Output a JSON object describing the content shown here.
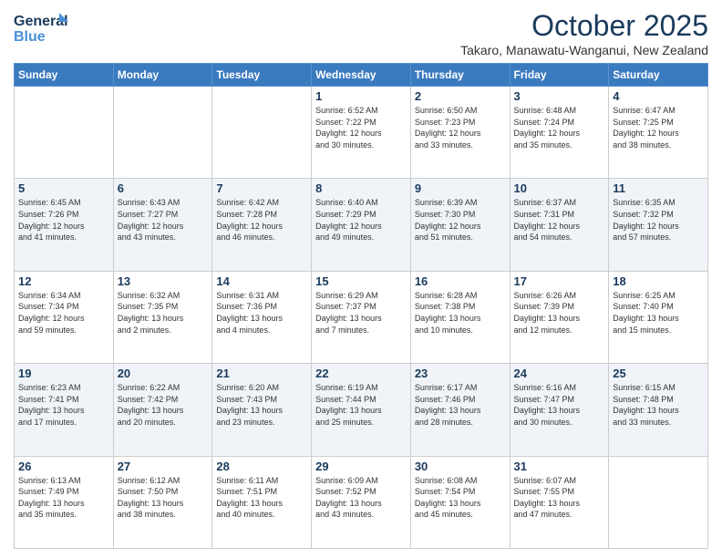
{
  "logo": {
    "line1": "General",
    "line2": "Blue"
  },
  "title": "October 2025",
  "location": "Takaro, Manawatu-Wanganui, New Zealand",
  "days_of_week": [
    "Sunday",
    "Monday",
    "Tuesday",
    "Wednesday",
    "Thursday",
    "Friday",
    "Saturday"
  ],
  "weeks": [
    [
      {
        "day": "",
        "info": ""
      },
      {
        "day": "",
        "info": ""
      },
      {
        "day": "",
        "info": ""
      },
      {
        "day": "1",
        "info": "Sunrise: 6:52 AM\nSunset: 7:22 PM\nDaylight: 12 hours\nand 30 minutes."
      },
      {
        "day": "2",
        "info": "Sunrise: 6:50 AM\nSunset: 7:23 PM\nDaylight: 12 hours\nand 33 minutes."
      },
      {
        "day": "3",
        "info": "Sunrise: 6:48 AM\nSunset: 7:24 PM\nDaylight: 12 hours\nand 35 minutes."
      },
      {
        "day": "4",
        "info": "Sunrise: 6:47 AM\nSunset: 7:25 PM\nDaylight: 12 hours\nand 38 minutes."
      }
    ],
    [
      {
        "day": "5",
        "info": "Sunrise: 6:45 AM\nSunset: 7:26 PM\nDaylight: 12 hours\nand 41 minutes."
      },
      {
        "day": "6",
        "info": "Sunrise: 6:43 AM\nSunset: 7:27 PM\nDaylight: 12 hours\nand 43 minutes."
      },
      {
        "day": "7",
        "info": "Sunrise: 6:42 AM\nSunset: 7:28 PM\nDaylight: 12 hours\nand 46 minutes."
      },
      {
        "day": "8",
        "info": "Sunrise: 6:40 AM\nSunset: 7:29 PM\nDaylight: 12 hours\nand 49 minutes."
      },
      {
        "day": "9",
        "info": "Sunrise: 6:39 AM\nSunset: 7:30 PM\nDaylight: 12 hours\nand 51 minutes."
      },
      {
        "day": "10",
        "info": "Sunrise: 6:37 AM\nSunset: 7:31 PM\nDaylight: 12 hours\nand 54 minutes."
      },
      {
        "day": "11",
        "info": "Sunrise: 6:35 AM\nSunset: 7:32 PM\nDaylight: 12 hours\nand 57 minutes."
      }
    ],
    [
      {
        "day": "12",
        "info": "Sunrise: 6:34 AM\nSunset: 7:34 PM\nDaylight: 12 hours\nand 59 minutes."
      },
      {
        "day": "13",
        "info": "Sunrise: 6:32 AM\nSunset: 7:35 PM\nDaylight: 13 hours\nand 2 minutes."
      },
      {
        "day": "14",
        "info": "Sunrise: 6:31 AM\nSunset: 7:36 PM\nDaylight: 13 hours\nand 4 minutes."
      },
      {
        "day": "15",
        "info": "Sunrise: 6:29 AM\nSunset: 7:37 PM\nDaylight: 13 hours\nand 7 minutes."
      },
      {
        "day": "16",
        "info": "Sunrise: 6:28 AM\nSunset: 7:38 PM\nDaylight: 13 hours\nand 10 minutes."
      },
      {
        "day": "17",
        "info": "Sunrise: 6:26 AM\nSunset: 7:39 PM\nDaylight: 13 hours\nand 12 minutes."
      },
      {
        "day": "18",
        "info": "Sunrise: 6:25 AM\nSunset: 7:40 PM\nDaylight: 13 hours\nand 15 minutes."
      }
    ],
    [
      {
        "day": "19",
        "info": "Sunrise: 6:23 AM\nSunset: 7:41 PM\nDaylight: 13 hours\nand 17 minutes."
      },
      {
        "day": "20",
        "info": "Sunrise: 6:22 AM\nSunset: 7:42 PM\nDaylight: 13 hours\nand 20 minutes."
      },
      {
        "day": "21",
        "info": "Sunrise: 6:20 AM\nSunset: 7:43 PM\nDaylight: 13 hours\nand 23 minutes."
      },
      {
        "day": "22",
        "info": "Sunrise: 6:19 AM\nSunset: 7:44 PM\nDaylight: 13 hours\nand 25 minutes."
      },
      {
        "day": "23",
        "info": "Sunrise: 6:17 AM\nSunset: 7:46 PM\nDaylight: 13 hours\nand 28 minutes."
      },
      {
        "day": "24",
        "info": "Sunrise: 6:16 AM\nSunset: 7:47 PM\nDaylight: 13 hours\nand 30 minutes."
      },
      {
        "day": "25",
        "info": "Sunrise: 6:15 AM\nSunset: 7:48 PM\nDaylight: 13 hours\nand 33 minutes."
      }
    ],
    [
      {
        "day": "26",
        "info": "Sunrise: 6:13 AM\nSunset: 7:49 PM\nDaylight: 13 hours\nand 35 minutes."
      },
      {
        "day": "27",
        "info": "Sunrise: 6:12 AM\nSunset: 7:50 PM\nDaylight: 13 hours\nand 38 minutes."
      },
      {
        "day": "28",
        "info": "Sunrise: 6:11 AM\nSunset: 7:51 PM\nDaylight: 13 hours\nand 40 minutes."
      },
      {
        "day": "29",
        "info": "Sunrise: 6:09 AM\nSunset: 7:52 PM\nDaylight: 13 hours\nand 43 minutes."
      },
      {
        "day": "30",
        "info": "Sunrise: 6:08 AM\nSunset: 7:54 PM\nDaylight: 13 hours\nand 45 minutes."
      },
      {
        "day": "31",
        "info": "Sunrise: 6:07 AM\nSunset: 7:55 PM\nDaylight: 13 hours\nand 47 minutes."
      },
      {
        "day": "",
        "info": ""
      }
    ]
  ]
}
